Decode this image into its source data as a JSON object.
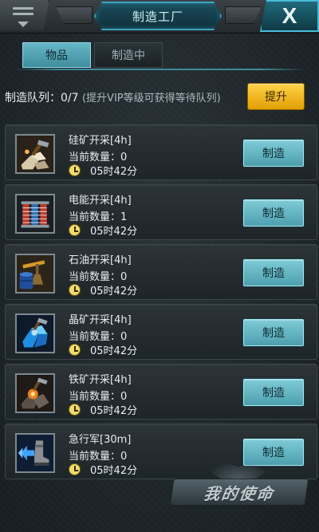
{
  "header": {
    "title": "制造工厂",
    "close_label": "X"
  },
  "tabs": [
    {
      "label": "物品",
      "active": true
    },
    {
      "label": "制造中",
      "active": false
    }
  ],
  "queue": {
    "label": "制造队列：",
    "count": "0/7",
    "hint": "(提升VIP等级可获得等待队列)",
    "upgrade_label": "提升"
  },
  "items": [
    {
      "name": "硅矿开采[4h]",
      "qty": "当前数量：0",
      "time": "05时42分",
      "button": "制造",
      "icon": "silicon-ore-icon"
    },
    {
      "name": "电能开采[4h]",
      "qty": "当前数量：1",
      "time": "05时42分",
      "button": "制造",
      "icon": "power-coil-icon"
    },
    {
      "name": "石油开采[4h]",
      "qty": "当前数量：0",
      "time": "05时42分",
      "button": "制造",
      "icon": "oil-pump-icon"
    },
    {
      "name": "晶矿开采[4h]",
      "qty": "当前数量：0",
      "time": "05时42分",
      "button": "制造",
      "icon": "crystal-ore-icon"
    },
    {
      "name": "铁矿开采[4h]",
      "qty": "当前数量：0",
      "time": "05时42分",
      "button": "制造",
      "icon": "iron-ore-icon"
    },
    {
      "name": "急行军[30m]",
      "qty": "当前数量：0",
      "time": "05时42分",
      "button": "制造",
      "icon": "march-boot-icon"
    }
  ],
  "watermark": {
    "text": "我的使命"
  },
  "colors": {
    "accent_cyan": "#4fb3c4",
    "upgrade_gold": "#f2b818",
    "clock_yellow": "#f1dc6b"
  }
}
